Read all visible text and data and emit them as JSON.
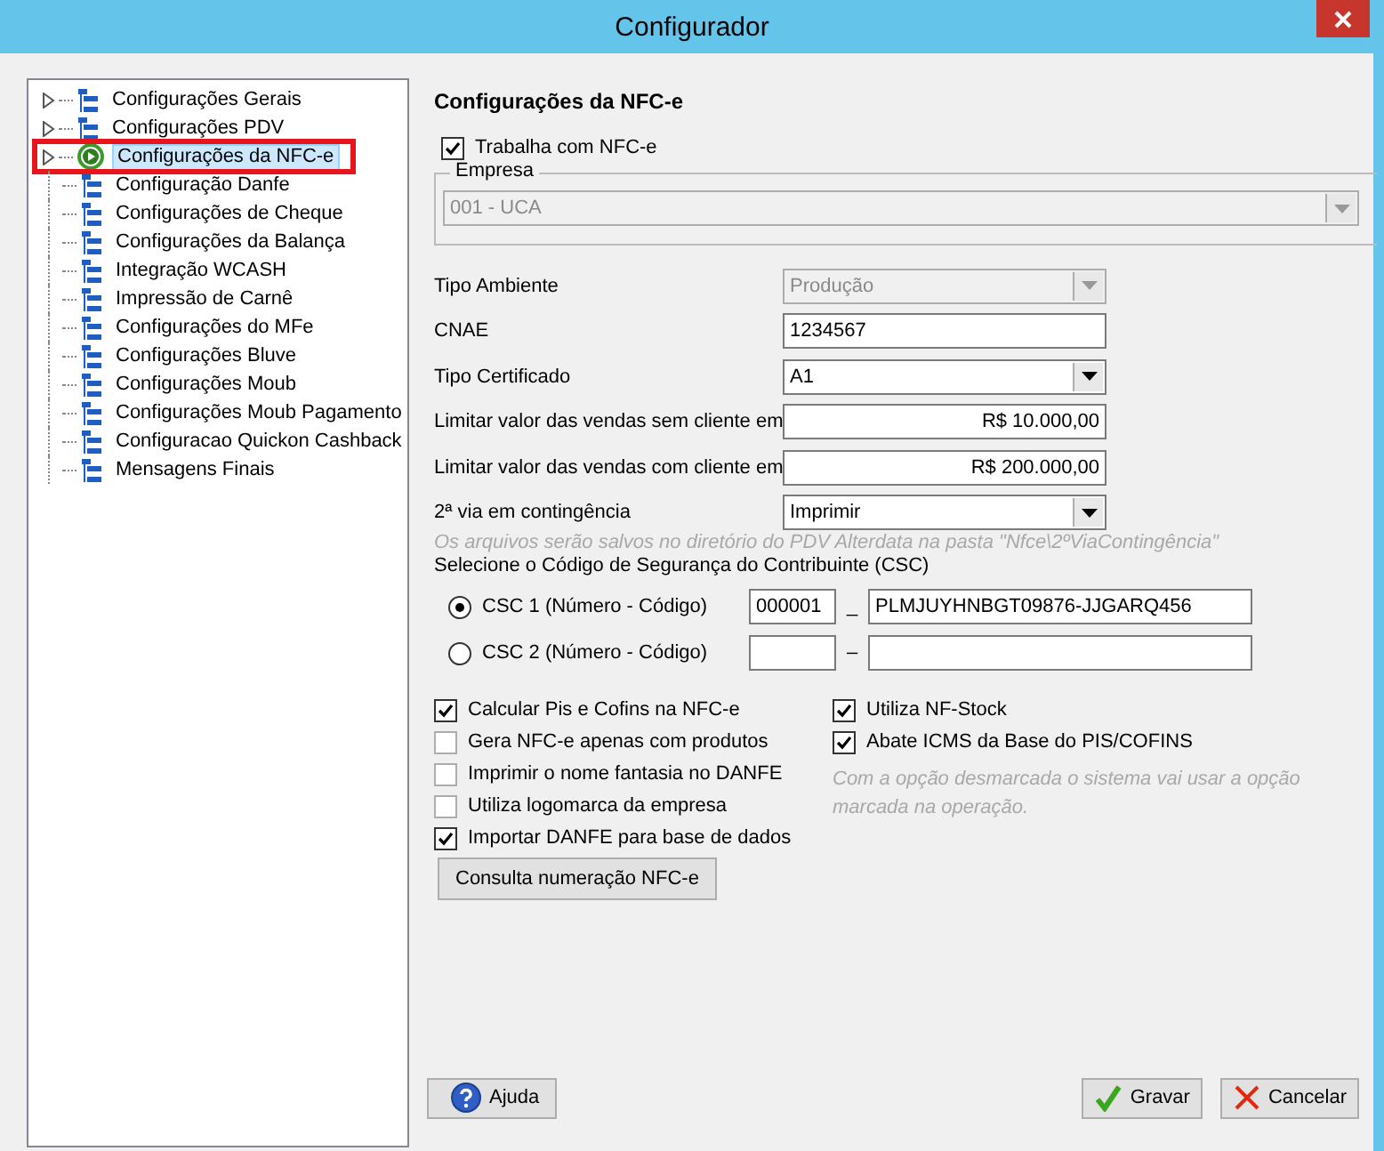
{
  "window": {
    "title": "Configurador"
  },
  "tree": {
    "items": [
      {
        "label": "Configurações Gerais",
        "expandable": true,
        "selected": false
      },
      {
        "label": "Configurações PDV",
        "expandable": true,
        "selected": false
      },
      {
        "label": "Configurações da NFC-e",
        "expandable": true,
        "selected": true
      },
      {
        "label": "Configuração Danfe",
        "expandable": false,
        "selected": false
      },
      {
        "label": "Configurações de Cheque",
        "expandable": false,
        "selected": false
      },
      {
        "label": "Configurações da Balança",
        "expandable": false,
        "selected": false
      },
      {
        "label": "Integração WCASH",
        "expandable": false,
        "selected": false
      },
      {
        "label": "Impressão de Carnê",
        "expandable": false,
        "selected": false
      },
      {
        "label": "Configurações do MFe",
        "expandable": false,
        "selected": false
      },
      {
        "label": "Configurações Bluve",
        "expandable": false,
        "selected": false
      },
      {
        "label": "Configurações Moub",
        "expandable": false,
        "selected": false
      },
      {
        "label": "Configurações Moub Pagamento",
        "expandable": false,
        "selected": false
      },
      {
        "label": "Configuracao Quickon Cashback",
        "expandable": false,
        "selected": false
      },
      {
        "label": "Mensagens Finais",
        "expandable": false,
        "selected": false
      }
    ]
  },
  "form": {
    "heading": "Configurações da NFC-e",
    "works_with": {
      "label": "Trabalha com NFC-e",
      "checked": true
    },
    "empresa": {
      "legend": "Empresa",
      "value": "001 - UCA",
      "disabled": true
    },
    "fields": [
      {
        "label": "Tipo Ambiente",
        "kind": "select",
        "value": "Produção",
        "disabled": true
      },
      {
        "label": "CNAE",
        "kind": "text",
        "value": "1234567",
        "disabled": false
      },
      {
        "label": "Tipo Certificado",
        "kind": "select",
        "value": "A1",
        "disabled": false
      },
      {
        "label": "Limitar valor das vendas sem cliente em",
        "kind": "amount",
        "value": "R$ 10.000,00",
        "disabled": false
      },
      {
        "label": "Limitar valor das vendas com cliente em",
        "kind": "amount",
        "value": "R$ 200.000,00",
        "disabled": false
      },
      {
        "label": "2ª via em contingência",
        "kind": "select",
        "value": "Imprimir",
        "disabled": false
      }
    ],
    "hint": "Os arquivos serão salvos no diretório do PDV Alterdata na pasta \"Nfce\\2ºViaContingência\"",
    "csc_title": "Selecione o Código de Segurança do Contribuinte (CSC)",
    "csc": [
      {
        "label": "CSC 1 (Número - Código)",
        "selected": true,
        "separator": "_",
        "number": "000001",
        "code": "PLMJUYHNBGT09876-JJGARQ456"
      },
      {
        "label": "CSC 2 (Número - Código)",
        "selected": false,
        "separator": "–"
      }
    ],
    "checks_left": [
      {
        "label": "Calcular Pis e Cofins na NFC-e",
        "checked": true
      },
      {
        "label": "Gera NFC-e apenas com produtos",
        "checked": false
      },
      {
        "label": "Imprimir o nome fantasia no DANFE",
        "checked": false
      },
      {
        "label": "Utiliza logomarca da empresa",
        "checked": false
      },
      {
        "label": "Importar DANFE para base de dados",
        "checked": true
      }
    ],
    "checks_right": [
      {
        "label": "Utiliza NF-Stock",
        "checked": true
      },
      {
        "label": "Abate ICMS da Base do PIS/COFINS",
        "checked": true
      }
    ],
    "note": "Com a opção desmarcada o sistema vai usar a opção marcada na operação.",
    "consult_button": "Consulta numeração NFC-e"
  },
  "buttons": {
    "help": "Ajuda",
    "save": "Gravar",
    "cancel": "Cancelar"
  }
}
